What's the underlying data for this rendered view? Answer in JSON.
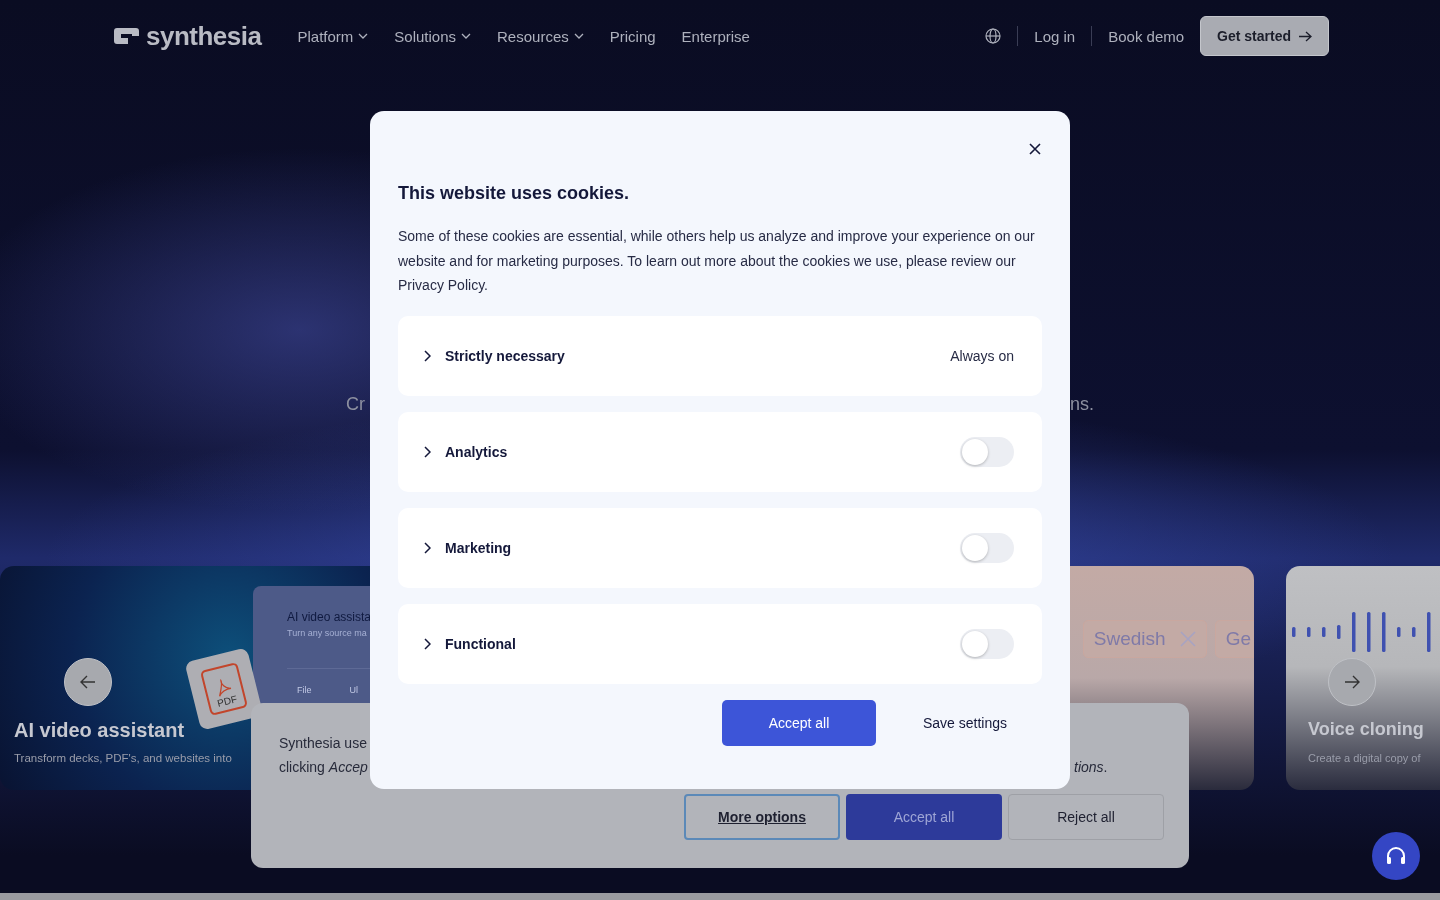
{
  "nav": {
    "logo": "synthesia",
    "items": [
      {
        "label": "Platform",
        "dropdown": true
      },
      {
        "label": "Solutions",
        "dropdown": true
      },
      {
        "label": "Resources",
        "dropdown": true
      },
      {
        "label": "Pricing",
        "dropdown": false
      },
      {
        "label": "Enterprise",
        "dropdown": false
      }
    ],
    "login": "Log in",
    "demo": "Book demo",
    "cta": "Get started"
  },
  "hero": {
    "subtitle_fragments": [
      "Cr",
      "ns."
    ]
  },
  "carousel": {
    "cards": [
      {
        "kind": "feature",
        "title": "AI video assistant",
        "description": "Transform decks, PDF's, and websites into",
        "mockup": {
          "title": "AI video assista",
          "subtitle": "Turn any source ma",
          "tabs": [
            "File",
            "Ul"
          ]
        },
        "badge": "PDF"
      },
      {
        "kind": "languages",
        "chips": [
          {
            "label": "Swedish",
            "removable": true
          },
          {
            "label": "Ge",
            "removable": false
          }
        ]
      },
      {
        "kind": "voice",
        "title": "Voice cloning",
        "description": "Create a digital copy of"
      }
    ]
  },
  "cookie_banner": {
    "lines": [
      "Synthesia use",
      "clicking *Accep*"
    ],
    "tail": "*tions*.",
    "buttons": [
      {
        "label": "More options",
        "kind": "outline"
      },
      {
        "label": "Accept all",
        "kind": "primary"
      },
      {
        "label": "Reject all",
        "kind": "secondary"
      }
    ]
  },
  "modal": {
    "title": "This website uses cookies.",
    "body": "Some of these cookies are essential, while others help us analyze and improve your experience on our website and for marketing purposes. To learn out more about the cookies we use, please review our Privacy Policy.",
    "categories": [
      {
        "label": "Strictly necessary",
        "kind": "fixed",
        "status": "Always on"
      },
      {
        "label": "Analytics",
        "kind": "toggle",
        "on": false
      },
      {
        "label": "Marketing",
        "kind": "toggle",
        "on": false
      },
      {
        "label": "Functional",
        "kind": "toggle",
        "on": false
      }
    ],
    "buttons": [
      {
        "label": "Accept all",
        "kind": "primary"
      },
      {
        "label": "Save settings",
        "kind": "plain"
      }
    ]
  }
}
